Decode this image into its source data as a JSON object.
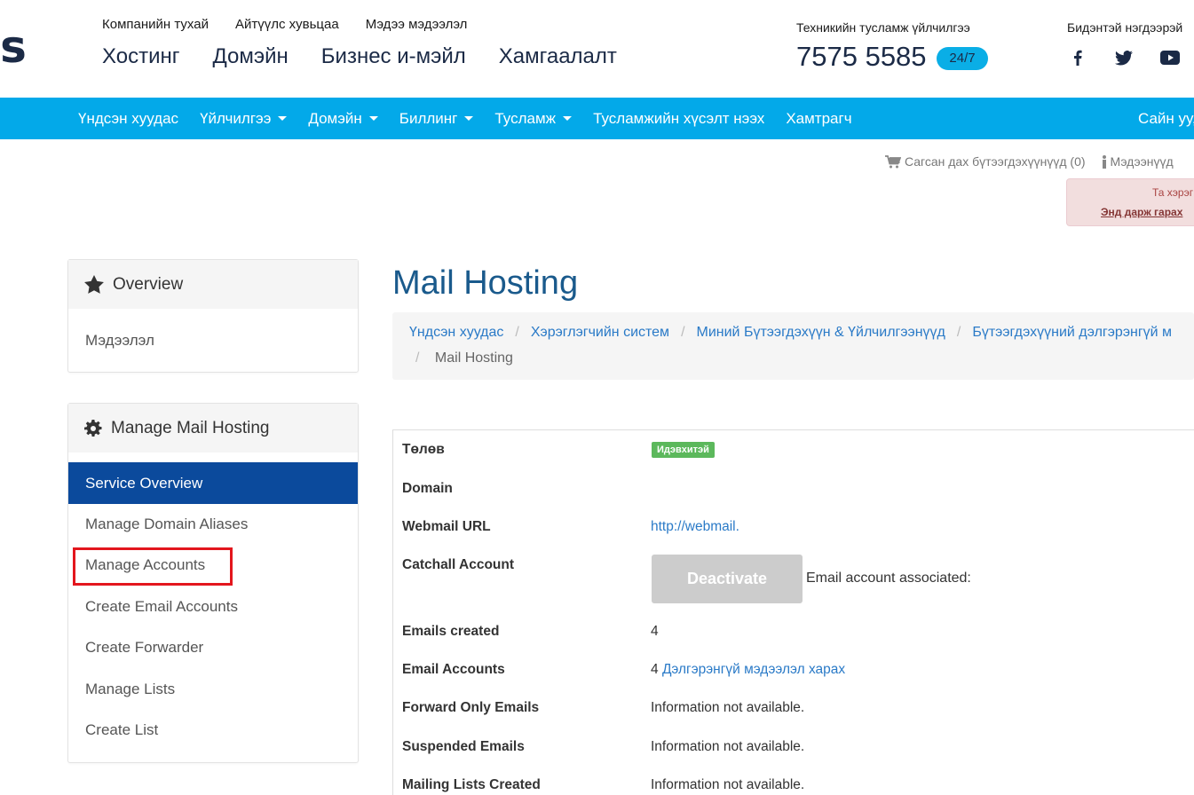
{
  "logo_text": "ls",
  "top_links": [
    "Компанийн тухай",
    "Айтүүлс хувьцаа",
    "Мэдээ мэдээлэл"
  ],
  "main_links": [
    "Хостинг",
    "Домэйн",
    "Бизнес и-мэйл",
    "Хамгаалалт"
  ],
  "support": {
    "label": "Техникийн тусламж үйлчилгээ",
    "phone": "7575 5585",
    "badge": "24/7"
  },
  "social": {
    "label": "Бидэнтэй нэгдээрэй",
    "icons": [
      "facebook-icon",
      "twitter-icon",
      "youtube-icon"
    ]
  },
  "nav": {
    "items": [
      {
        "label": "Үндсэн хуудас",
        "dropdown": false
      },
      {
        "label": "Үйлчилгээ",
        "dropdown": true
      },
      {
        "label": "Домэйн",
        "dropdown": true
      },
      {
        "label": "Биллинг",
        "dropdown": true
      },
      {
        "label": "Тусламж",
        "dropdown": true
      },
      {
        "label": "Тусламжийн хүсэлт нээх",
        "dropdown": false
      },
      {
        "label": "Хамтрагч",
        "dropdown": false
      }
    ],
    "right": "Сайн уу,"
  },
  "cart": {
    "cart_label": "Сагсан дах бүтээгдэхүүнүүд (0)",
    "info_label": "Мэдээнүүд"
  },
  "alert": {
    "line1": "Та хэрэг",
    "line2": "Энд дарж гарах"
  },
  "sidebar": {
    "overview_title": "Overview",
    "overview_item": "Мэдээлэл",
    "manage_title": "Manage Mail Hosting",
    "menu": [
      "Service Overview",
      "Manage Domain Aliases",
      "Manage Accounts",
      "Create Email Accounts",
      "Create Forwarder",
      "Manage Lists",
      "Create List"
    ]
  },
  "main": {
    "title": "Mail Hosting",
    "breadcrumb": [
      "Үндсэн хуудас",
      "Хэрэглэгчийн систем",
      "Миний Бүтээгдэхүүн & Үйлчилгээнүүд",
      "Бүтээгдэхүүний дэлгэрэнгүй м"
    ],
    "breadcrumb_current": "Mail Hosting",
    "rows": {
      "status_label": "Төлөв",
      "status_value": "Идэвхитэй",
      "domain_label": "Domain",
      "webmail_label": "Webmail URL",
      "webmail_value": "http://webmail.",
      "catchall_label": "Catchall Account",
      "deactivate_button": "Deactivate",
      "associated_text": "Email account associated:",
      "emails_created_label": "Emails created",
      "emails_created_value": "4",
      "email_accounts_label": "Email Accounts",
      "email_accounts_count": "4",
      "email_accounts_link": "Дэлгэрэнгүй мэдээлэл харах",
      "forward_label": "Forward Only Emails",
      "forward_value": "Information not available.",
      "suspended_label": "Suspended Emails",
      "suspended_value": "Information not available.",
      "mailing_label": "Mailing Lists Created",
      "mailing_value": "Information not available."
    }
  },
  "colors": {
    "navbar": "#03a9e9",
    "active_menu": "#0b4a9c",
    "highlight": "#e3161d",
    "status_badge": "#5cb85c",
    "link": "#2a7ac7"
  }
}
